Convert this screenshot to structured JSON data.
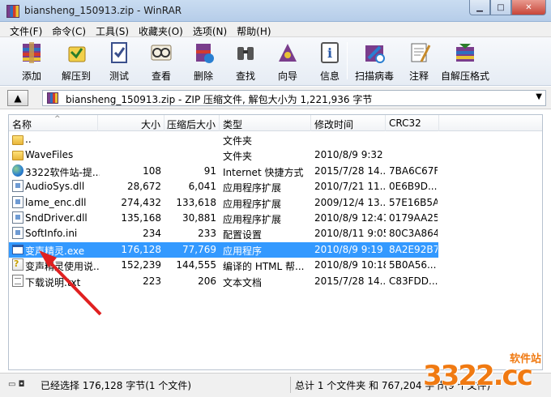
{
  "window": {
    "title": "biansheng_150913.zip - WinRAR",
    "minimize_glyph": "▁",
    "maximize_glyph": "□",
    "close_glyph": "✕"
  },
  "menu": [
    "文件(F)",
    "命令(C)",
    "工具(S)",
    "收藏夹(O)",
    "选项(N)",
    "帮助(H)"
  ],
  "toolbar": [
    {
      "label": "添加",
      "icon": "add-archive-icon"
    },
    {
      "label": "解压到",
      "icon": "extract-to-icon"
    },
    {
      "label": "测试",
      "icon": "test-icon"
    },
    {
      "label": "查看",
      "icon": "view-icon"
    },
    {
      "label": "删除",
      "icon": "delete-icon"
    },
    {
      "label": "查找",
      "icon": "find-icon"
    },
    {
      "label": "向导",
      "icon": "wizard-icon"
    },
    {
      "label": "信息",
      "icon": "info-icon"
    },
    {
      "label": "扫描病毒",
      "icon": "virus-scan-icon"
    },
    {
      "label": "注释",
      "icon": "comment-icon"
    },
    {
      "label": "自解压格式",
      "icon": "sfx-icon"
    }
  ],
  "address": {
    "path": "biansheng_150913.zip - ZIP 压缩文件, 解包大小为 1,221,936 字节"
  },
  "columns": [
    "名称",
    "大小",
    "压缩后大小",
    "类型",
    "修改时间",
    "CRC32"
  ],
  "files": [
    {
      "name": "..",
      "size": "",
      "packed": "",
      "type": "文件夹",
      "modified": "",
      "crc": "",
      "icon": "folder-icon",
      "selected": false
    },
    {
      "name": "WaveFiles",
      "size": "",
      "packed": "",
      "type": "文件夹",
      "modified": "2010/8/9 9:32",
      "crc": "",
      "icon": "folder-icon",
      "selected": false
    },
    {
      "name": "3322软件站-提...",
      "size": "108",
      "packed": "91",
      "type": "Internet 快捷方式",
      "modified": "2015/7/28 14...",
      "crc": "7BA6C67F",
      "icon": "globe-icon",
      "selected": false
    },
    {
      "name": "AudioSys.dll",
      "size": "28,672",
      "packed": "6,041",
      "type": "应用程序扩展",
      "modified": "2010/7/21 11...",
      "crc": "0E6B9D...",
      "icon": "dll-icon",
      "selected": false
    },
    {
      "name": "lame_enc.dll",
      "size": "274,432",
      "packed": "133,618",
      "type": "应用程序扩展",
      "modified": "2009/12/4 13...",
      "crc": "57E16B5A",
      "icon": "dll-icon",
      "selected": false
    },
    {
      "name": "SndDriver.dll",
      "size": "135,168",
      "packed": "30,881",
      "type": "应用程序扩展",
      "modified": "2010/8/9 12:41",
      "crc": "0179AA25",
      "icon": "dll-icon",
      "selected": false
    },
    {
      "name": "SoftInfo.ini",
      "size": "234",
      "packed": "233",
      "type": "配置设置",
      "modified": "2010/8/11 9:05",
      "crc": "80C3A864",
      "icon": "ini-icon",
      "selected": false
    },
    {
      "name": "变声精灵.exe",
      "size": "176,128",
      "packed": "77,769",
      "type": "应用程序",
      "modified": "2010/8/9 9:19",
      "crc": "8A2E92B7",
      "icon": "exe-icon",
      "selected": true
    },
    {
      "name": "变声精灵使用说...",
      "size": "152,239",
      "packed": "144,555",
      "type": "编译的 HTML 帮...",
      "modified": "2010/8/9 10:18",
      "crc": "5B0A56...",
      "icon": "chm-icon",
      "selected": false
    },
    {
      "name": "下载说明.txt",
      "size": "223",
      "packed": "206",
      "type": "文本文档",
      "modified": "2015/7/28 14...",
      "crc": "C83FDD...",
      "icon": "txt-icon",
      "selected": false
    }
  ],
  "status": {
    "left": "已经选择 176,128 字节(1 个文件)",
    "right": "总计 1 个文件夹 和 767,204 字节(9 个文件)"
  },
  "watermark": {
    "main": "3322.cc",
    "sub": "软件站"
  }
}
